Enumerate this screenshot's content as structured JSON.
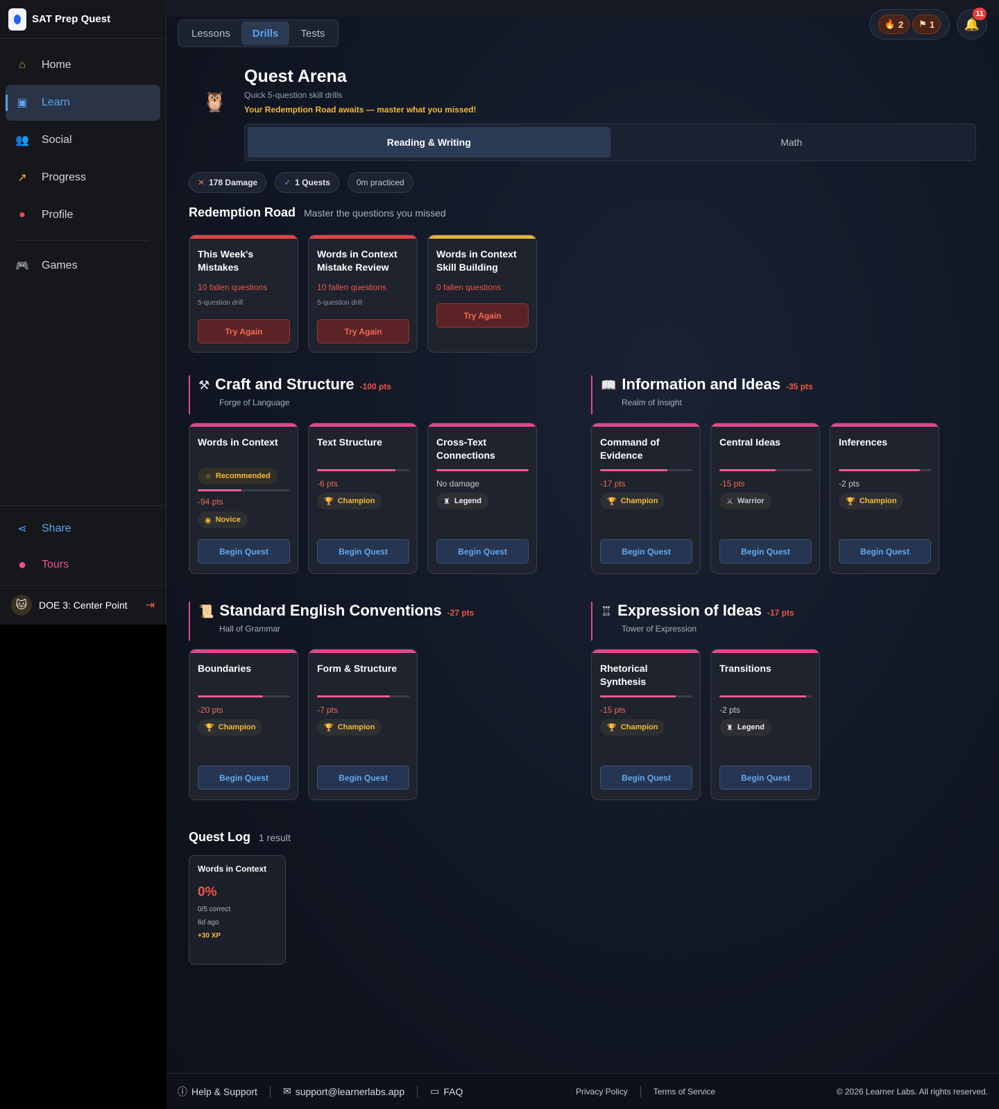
{
  "brand": {
    "name": "SAT Prep Quest"
  },
  "nav": {
    "home": "Home",
    "learn": "Learn",
    "social": "Social",
    "progress": "Progress",
    "profile": "Profile",
    "games": "Games",
    "share": "Share",
    "tours": "Tours"
  },
  "user": {
    "name": "DOE 3: Center Point"
  },
  "tabs": {
    "lessons": "Lessons",
    "drills": "Drills",
    "tests": "Tests"
  },
  "stats": {
    "streak": "2",
    "quests": "1",
    "notifications": "11"
  },
  "hero": {
    "title": "Quest Arena",
    "subtitle": "Quick 5-question skill drills",
    "alert": "Your Redemption Road awaits — master what you missed!"
  },
  "subjects": {
    "reading": "Reading & Writing",
    "math": "Math"
  },
  "chips": {
    "damage": "178 Damage",
    "quests": "1 Quests",
    "practiced": "0m practiced"
  },
  "redemption": {
    "title": "Redemption Road",
    "subtitle": "Master the questions you missed",
    "cards": [
      {
        "title": "This Week's Mistakes",
        "fallen": "10 fallen questions",
        "drill": "5-question drill",
        "button": "Try Again"
      },
      {
        "title": "Words in Context Mistake Review",
        "fallen": "10 fallen questions",
        "drill": "5-question drill",
        "button": "Try Again"
      },
      {
        "title": "Words in Context Skill Building",
        "fallen": "0 fallen questions",
        "button": "Try Again"
      }
    ]
  },
  "categories": {
    "craft": {
      "title": "Craft and Structure",
      "pts": "-100 pts",
      "sub": "Forge of Language",
      "cards": [
        {
          "title": "Words in Context",
          "rec": "Recommended",
          "pts": "-94 pts",
          "badge": "Novice",
          "button": "Begin Quest",
          "progress": 0.47
        },
        {
          "title": "Text Structure",
          "pts": "-6 pts",
          "badge": "Champion",
          "button": "Begin Quest",
          "progress": 0.85
        },
        {
          "title": "Cross-Text Connections",
          "pts": "No damage",
          "badge": "Legend",
          "button": "Begin Quest",
          "progress": 1.0
        }
      ]
    },
    "info": {
      "title": "Information and Ideas",
      "pts": "-35 pts",
      "sub": "Realm of Insight",
      "cards": [
        {
          "title": "Command of Evidence",
          "pts": "-17 pts",
          "badge": "Champion",
          "button": "Begin Quest",
          "progress": 0.73
        },
        {
          "title": "Central Ideas",
          "pts": "-15 pts",
          "badge": "Warrior",
          "button": "Begin Quest",
          "progress": 0.61
        },
        {
          "title": "Inferences",
          "pts": "-2 pts",
          "badge": "Champion",
          "button": "Begin Quest",
          "progress": 0.88
        }
      ]
    },
    "sec": {
      "title": "Standard English Conventions",
      "pts": "-27 pts",
      "sub": "Hall of Grammar",
      "cards": [
        {
          "title": "Boundaries",
          "pts": "-20 pts",
          "badge": "Champion",
          "button": "Begin Quest",
          "progress": 0.71
        },
        {
          "title": "Form & Structure",
          "pts": "-7 pts",
          "badge": "Champion",
          "button": "Begin Quest",
          "progress": 0.79
        }
      ]
    },
    "expr": {
      "title": "Expression of Ideas",
      "pts": "-17 pts",
      "sub": "Tower of Expression",
      "cards": [
        {
          "title": "Rhetorical Synthesis",
          "pts": "-15 pts",
          "badge": "Champion",
          "button": "Begin Quest",
          "progress": 0.82
        },
        {
          "title": "Transitions",
          "pts": "-2 pts",
          "badge": "Legend",
          "button": "Begin Quest",
          "progress": 0.94
        }
      ]
    }
  },
  "questlog": {
    "title": "Quest Log",
    "count": "1 result",
    "entry": {
      "title": "Words in Context",
      "pct": "0%",
      "correct": "0/5 correct",
      "ago": "6d ago",
      "xp": "+30 XP"
    }
  },
  "footer": {
    "help": "Help & Support",
    "email": "support@learnerlabs.app",
    "faq": "FAQ",
    "privacy": "Privacy Policy",
    "terms": "Terms of Service",
    "copyright": "© 2026 Learner Labs. All rights reserved."
  },
  "colors": {
    "accent": "#5aa3f0",
    "danger": "#f0564a",
    "gold": "#f5b938",
    "pink": "#ec4f9a"
  }
}
